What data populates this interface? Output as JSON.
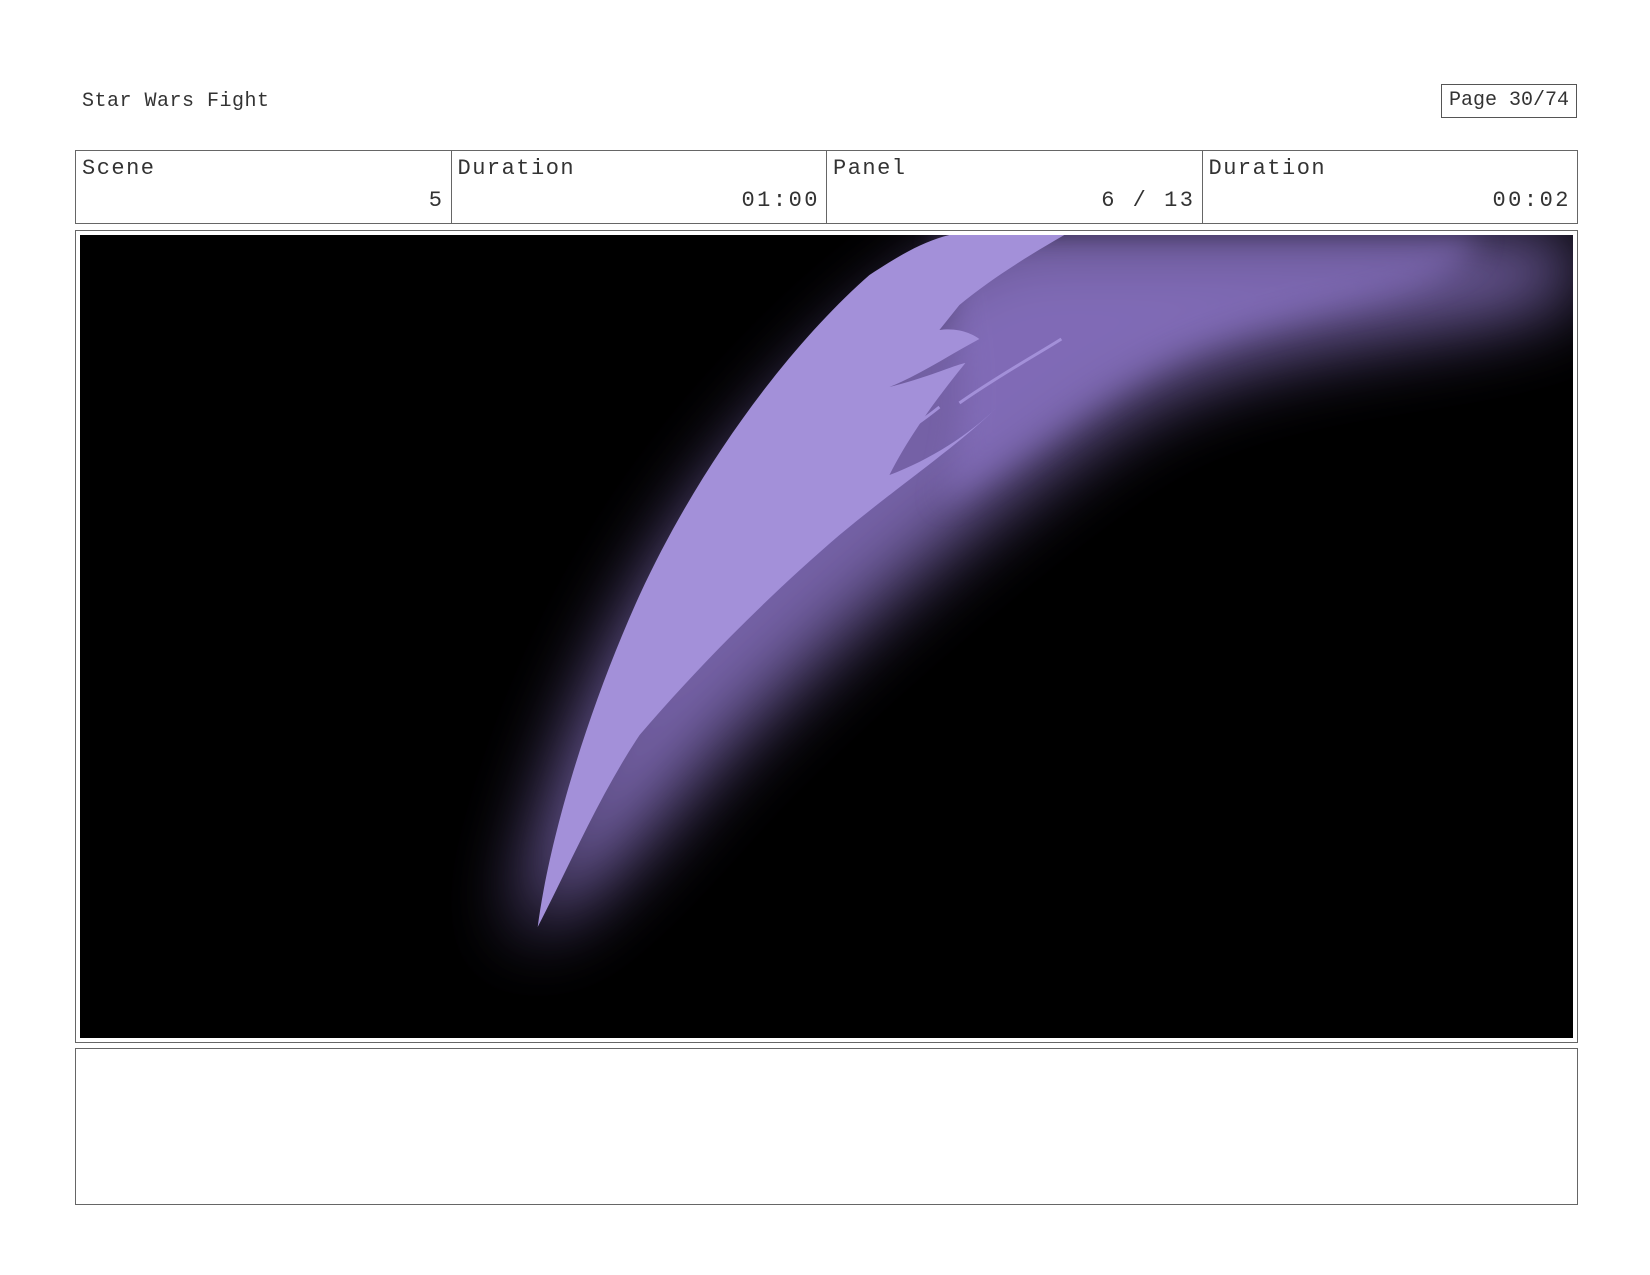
{
  "header": {
    "title": "Star Wars Fight",
    "page_indicator": "Page 30/74"
  },
  "info": {
    "scene_label": "Scene",
    "scene_value": "5",
    "scene_duration_label": "Duration",
    "scene_duration_value": "01:00",
    "panel_label": "Panel",
    "panel_value": "6 / 13",
    "panel_duration_label": "Duration",
    "panel_duration_value": "00:02"
  },
  "panel": {
    "background_color": "#000000",
    "slash_color": "#a390d9",
    "glow_color": "#8a73c4"
  },
  "notes": {
    "text": ""
  }
}
